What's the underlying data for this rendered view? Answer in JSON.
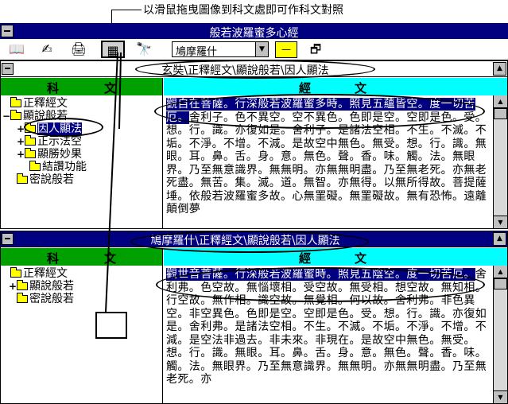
{
  "annotation": "以滑鼠拖曳圖像到科文處即可作科文對照",
  "window": {
    "title": "般若波羅蜜多心經"
  },
  "toolbar": {
    "buttons": [
      {
        "name": "book-icon",
        "glyph": "📖"
      },
      {
        "name": "edit-icon",
        "glyph": "✍"
      },
      {
        "name": "print-icon",
        "glyph": "🖨"
      },
      {
        "name": "compare-drag-icon",
        "glyph": "▦"
      },
      {
        "name": "binoculars-icon",
        "glyph": "🔭"
      }
    ],
    "translator_select": "鳩摩羅什",
    "highlight_glyph": "—"
  },
  "pane1": {
    "title": "玄奘\\正釋經文\\顯說般若\\因人顯法",
    "tree_header": [
      "科",
      "文"
    ],
    "text_header": [
      "經",
      "文"
    ],
    "tree": [
      {
        "label": "正釋經文",
        "toggle": "",
        "indent": 0
      },
      {
        "label": "顯說般若",
        "toggle": "−",
        "indent": 1
      },
      {
        "label": "因人顯法",
        "toggle": "+",
        "indent": 2,
        "selected": true
      },
      {
        "label": "正示法空",
        "toggle": "+",
        "indent": 2
      },
      {
        "label": "顯勝妙果",
        "toggle": "+",
        "indent": 2
      },
      {
        "label": "結讚功能",
        "toggle": "",
        "indent": 2
      },
      {
        "label": "密說般若",
        "toggle": "",
        "indent": 1
      }
    ],
    "text_highlight": "觀自在菩薩。行深般若波羅蜜多時。照見五蘊皆空。度一切苦厄。",
    "text_rest": "舍利子。色不異空。空不異色。色即是空。空即是色。受。想。行。識。亦復如是。舍利子。是諸法空相。不生。不滅。不垢。不淨。不增。不減。是故空中無色。無受。想。行。識。無眼。耳。鼻。舌。身。意。無色。聲。香。味。觸。法。無眼界。乃至無意識界。無無明。亦無無明盡。乃至無老死。亦無老死盡。無苦。集。滅。道。無智。亦無得。以無所得故。菩提薩埵。依般若波羅蜜多故。心無罣礙。無罣礙故。無有恐怖。遠離顛倒夢"
  },
  "pane2": {
    "title": "鳩摩羅什\\正釋經文\\顯說般若\\因人顯法",
    "tree_header": [
      "科",
      "文"
    ],
    "text_header": [
      "經",
      "文"
    ],
    "tree": [
      {
        "label": "正釋經文",
        "toggle": "",
        "indent": 0
      },
      {
        "label": "顯說般若",
        "toggle": "+",
        "indent": 1
      },
      {
        "label": "密說般若",
        "toggle": "",
        "indent": 1
      }
    ],
    "text_highlight": "觀世音菩薩。行深般若波羅蜜時。照見五陰空。度一切苦厄。",
    "text_rest": "舍利弗。色空故。無惱壞相。受空故。無受相。想空故。無知相。行空故。無作相。識空故。無覺相。何以故。舍利弗。非色異空。非空異色。色即是空。空即是色。受。想。行。識。亦復如是。舍利弗。是諸法空相。不生。不滅。不垢。不淨。不增。不減。是空法非過去。非未來。非現在。是故空中無色。無受。想。行。識。無眼。耳。鼻。舌。身。意。無色。聲。香。味。觸。法。無眼界。乃至無意識界。無無明。亦無無明盡。乃至無老死。亦"
  }
}
